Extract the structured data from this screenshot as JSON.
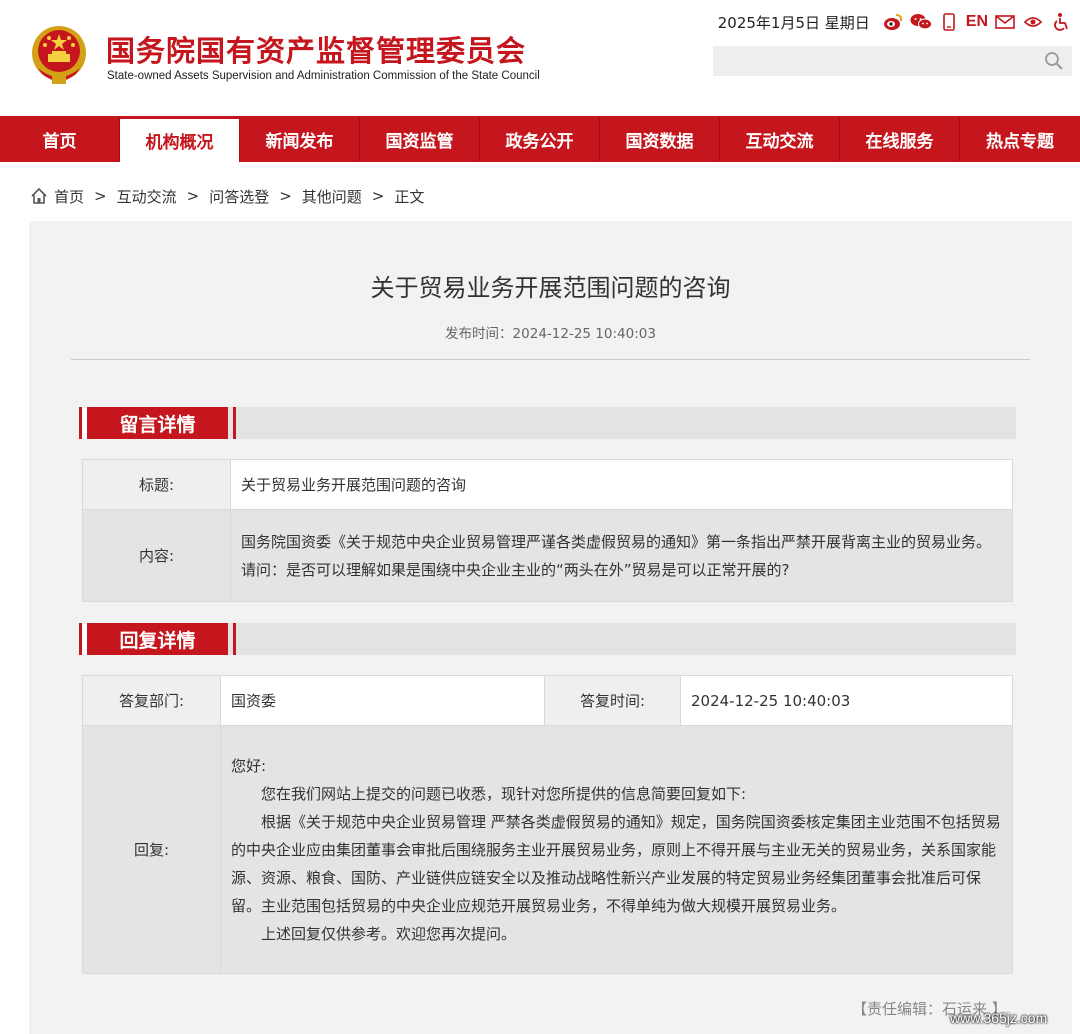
{
  "header": {
    "title_cn": "国务院国有资产监督管理委员会",
    "title_en": "State-owned Assets Supervision and Administration Commission of the State Council",
    "date": "2025年1月5日 星期日",
    "en_label": "EN",
    "search_placeholder": ""
  },
  "nav": {
    "items": [
      "首页",
      "机构概况",
      "新闻发布",
      "国资监管",
      "政务公开",
      "国资数据",
      "互动交流",
      "在线服务",
      "热点专题"
    ],
    "active_index": 1
  },
  "breadcrumb": {
    "items": [
      "首页",
      "互动交流",
      "问答选登",
      "其他问题"
    ],
    "current": "正文",
    "separator": ">"
  },
  "article": {
    "title": "关于贸易业务开展范围问题的咨询",
    "publish_time": "发布时间：2024-12-25 10:40:03"
  },
  "message_section": {
    "heading": "留言详情",
    "title_label": "标题:",
    "title_value": "关于贸易业务开展范围问题的咨询",
    "content_label": "内容:",
    "content_value": "国务院国资委《关于规范中央企业贸易管理严谨各类虚假贸易的通知》第一条指出严禁开展背离主业的贸易业务。请问：是否可以理解如果是围绕中央企业主业的“两头在外”贸易是可以正常开展的?"
  },
  "reply_section": {
    "heading": "回复详情",
    "dept_label": "答复部门:",
    "dept_value": "国资委",
    "time_label": "答复时间:",
    "time_value": "2024-12-25 10:40:03",
    "reply_label": "回复:",
    "reply_greeting": "您好:",
    "reply_p1": "您在我们网站上提交的问题已收悉，现针对您所提供的信息简要回复如下:",
    "reply_p2": "根据《关于规范中央企业贸易管理 严禁各类虚假贸易的通知》规定，国务院国资委核定集团主业范围不包括贸易的中央企业应由集团董事会审批后围绕服务主业开展贸易业务，原则上不得开展与主业无关的贸易业务，关系国家能源、资源、粮食、国防、产业链供应链安全以及推动战略性新兴产业发展的特定贸易业务经集团董事会批准后可保留。主业范围包括贸易的中央企业应规范开展贸易业务，不得单纯为做大规模开展贸易业务。",
    "reply_p3": "上述回复仅供参考。欢迎您再次提问。"
  },
  "footer": {
    "editor": "【责任编辑：石运来 】",
    "watermark": "www.365jz.com"
  },
  "colors": {
    "brand_red": "#c4161c",
    "panel_gray": "#f2f2f2"
  }
}
